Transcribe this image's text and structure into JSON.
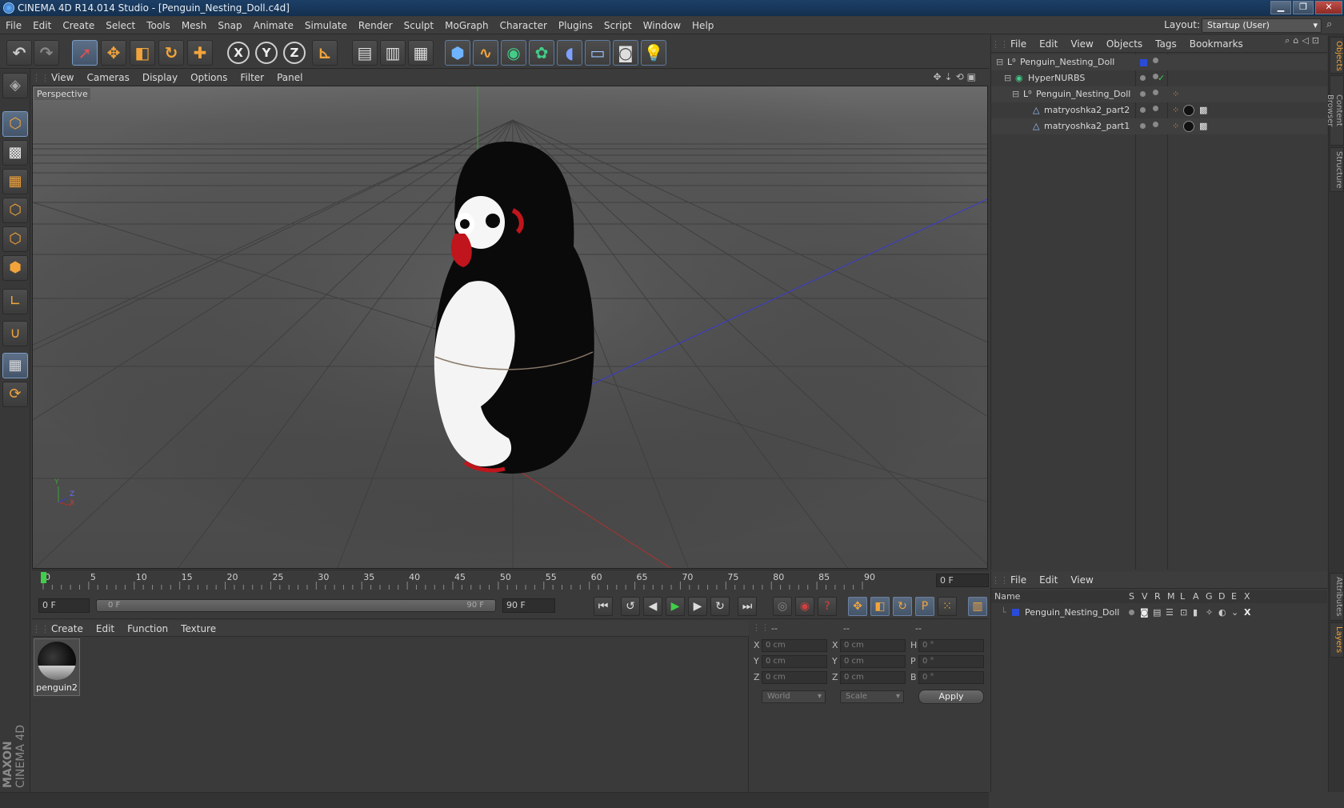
{
  "window": {
    "title": "CINEMA 4D R14.014 Studio - [Penguin_Nesting_Doll.c4d]",
    "minimize": "▁",
    "maximize": "❐",
    "close": "✕"
  },
  "menubar": {
    "items": [
      "File",
      "Edit",
      "Create",
      "Select",
      "Tools",
      "Mesh",
      "Snap",
      "Animate",
      "Simulate",
      "Render",
      "Sculpt",
      "MoGraph",
      "Character",
      "Plugins",
      "Script",
      "Window",
      "Help"
    ],
    "layout_label": "Layout:",
    "layout_value": "Startup (User)"
  },
  "toolbar": {
    "axis_x": "X",
    "axis_y": "Y",
    "axis_z": "Z"
  },
  "viewport": {
    "menu": [
      "View",
      "Cameras",
      "Display",
      "Options",
      "Filter",
      "Panel"
    ],
    "label": "Perspective",
    "axis_labels": {
      "y": "Y",
      "z": "Z",
      "x": "X"
    }
  },
  "timeline": {
    "ticks": [
      "0",
      "5",
      "10",
      "15",
      "20",
      "25",
      "30",
      "35",
      "40",
      "45",
      "50",
      "55",
      "60",
      "65",
      "70",
      "75",
      "80",
      "85",
      "90"
    ],
    "current_frame": "0 F"
  },
  "playbar": {
    "start_field": "0 F",
    "range_start": "0 F",
    "range_end": "90 F",
    "end_field": "90 F"
  },
  "material_manager": {
    "menu": [
      "Create",
      "Edit",
      "Function",
      "Texture"
    ],
    "materials": [
      {
        "name": "penguin2"
      }
    ]
  },
  "coordinates": {
    "header": [
      "--",
      "--",
      "--"
    ],
    "rows": [
      {
        "pos_label": "X",
        "pos": "0 cm",
        "size_label": "X",
        "size": "0 cm",
        "rot_label": "H",
        "rot": "0 °"
      },
      {
        "pos_label": "Y",
        "pos": "0 cm",
        "size_label": "Y",
        "size": "0 cm",
        "rot_label": "P",
        "rot": "0 °"
      },
      {
        "pos_label": "Z",
        "pos": "0 cm",
        "size_label": "Z",
        "size": "0 cm",
        "rot_label": "B",
        "rot": "0 °"
      }
    ],
    "mode": "World",
    "type": "Scale",
    "apply": "Apply"
  },
  "object_manager": {
    "menu": [
      "File",
      "Edit",
      "View",
      "Objects",
      "Tags",
      "Bookmarks"
    ],
    "objects": [
      {
        "name": "Penguin_Nesting_Doll"
      },
      {
        "name": "HyperNURBS"
      },
      {
        "name": "Penguin_Nesting_Doll"
      },
      {
        "name": "matryoshka2_part2"
      },
      {
        "name": "matryoshka2_part1"
      }
    ]
  },
  "layer_manager": {
    "menu": [
      "File",
      "Edit",
      "View"
    ],
    "columns": [
      "Name",
      "S",
      "V",
      "R",
      "M",
      "L",
      "A",
      "G",
      "D",
      "E",
      "X"
    ],
    "layers": [
      {
        "name": "Penguin_Nesting_Doll",
        "color": "#2a4bd8"
      }
    ]
  },
  "right_tabs": [
    "Objects",
    "Content Browser",
    "Structure",
    "Attributes",
    "Layers"
  ],
  "branding": {
    "maxon": "MAXON",
    "product": "CINEMA 4D"
  },
  "colors": {
    "accent": "#f2a43a",
    "x_axis": "#b03030",
    "y_axis": "#3aa03a",
    "z_axis": "#3a3ad0"
  }
}
